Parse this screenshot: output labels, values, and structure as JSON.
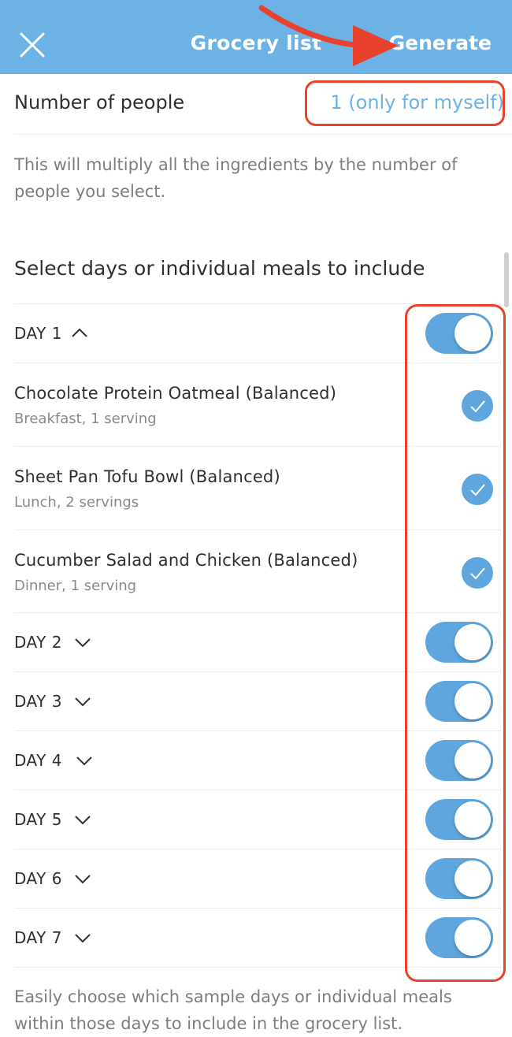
{
  "header": {
    "title": "Grocery list",
    "generate_label": "Generate",
    "background": "#6cb2e4"
  },
  "people": {
    "label": "Number of people",
    "value": "1 (only for myself)",
    "help": "This will multiply all the ingredients by the number of people you select."
  },
  "section": {
    "heading": "Select days or individual meals to include"
  },
  "days": [
    {
      "label": "DAY 1",
      "expanded": true,
      "enabled": true
    },
    {
      "label": "DAY 2",
      "expanded": false,
      "enabled": true
    },
    {
      "label": "DAY 3",
      "expanded": false,
      "enabled": true
    },
    {
      "label": "DAY 4",
      "expanded": false,
      "enabled": true
    },
    {
      "label": "DAY 5",
      "expanded": false,
      "enabled": true
    },
    {
      "label": "DAY 6",
      "expanded": false,
      "enabled": true
    },
    {
      "label": "DAY 7",
      "expanded": false,
      "enabled": true
    }
  ],
  "meals": [
    {
      "name": "Chocolate Protein Oatmeal (Balanced)",
      "detail": "Breakfast, 1 serving",
      "checked": true
    },
    {
      "name": "Sheet Pan Tofu Bowl (Balanced)",
      "detail": "Lunch, 2 servings",
      "checked": true
    },
    {
      "name": "Cucumber Salad and Chicken (Balanced)",
      "detail": "Dinner, 1 serving",
      "checked": true
    }
  ],
  "footer": {
    "text": "Easily choose which sample days or individual meals within those days to include in the grocery list."
  },
  "colors": {
    "accent": "#5ea6dd",
    "annotation": "#e8412c"
  },
  "icons": [
    "close-icon",
    "chevron-up-icon",
    "chevron-down-icon",
    "checkmark-icon"
  ]
}
